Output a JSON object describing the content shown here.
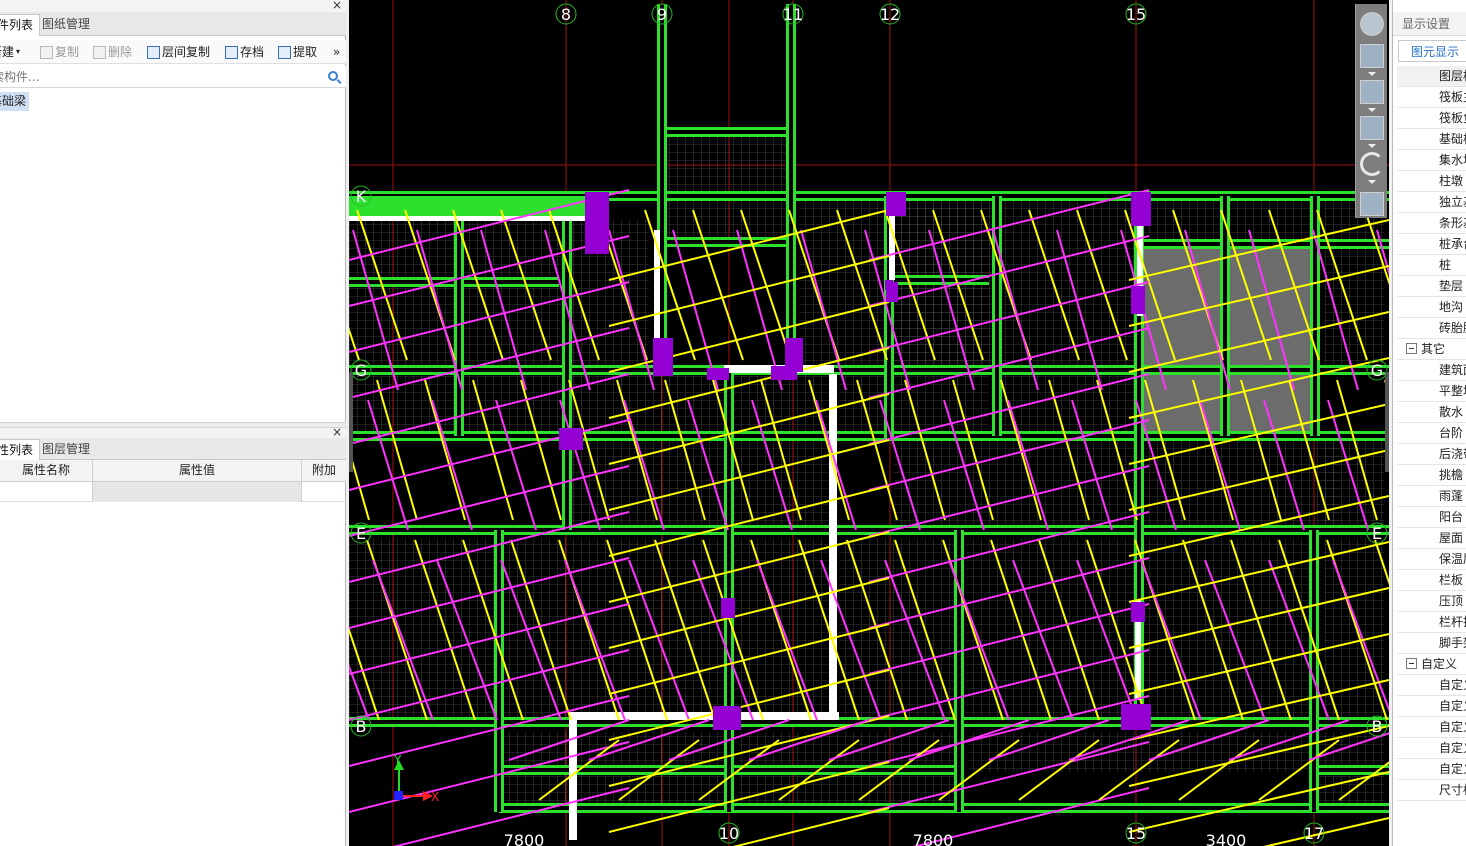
{
  "left_panel": {
    "top_tabs": [
      "构件列表",
      "图纸管理"
    ],
    "toolbar": {
      "new": "新建",
      "copy": "复制",
      "delete": "删除",
      "floor_copy": "层间复制",
      "save": "存档",
      "extract": "提取",
      "more": "»"
    },
    "search_placeholder": "搜索构件...",
    "tree_item": "基础梁",
    "bottom_tabs": [
      "属性列表",
      "图层管理"
    ],
    "prop_columns": [
      "属性名称",
      "属性值",
      "附加"
    ],
    "close_glyph": "×"
  },
  "canvas": {
    "axis_labels_top": [
      "8",
      "9",
      "11",
      "12",
      "15"
    ],
    "axis_labels_left": [
      "K",
      "G",
      "E",
      "B"
    ],
    "axis_labels_right": [
      "G",
      "E",
      "B"
    ],
    "axis_labels_bottom": [
      "10",
      "15",
      "17"
    ],
    "dimensions_bottom": [
      "7800",
      "7800",
      "3400"
    ],
    "ucs": {
      "y": "Y",
      "x": "X"
    },
    "colors": {
      "background": "#000000",
      "grid": "#7a7a7a",
      "beam": "#2ee02e",
      "axis_line": "#a01010",
      "rebar_yellow": "#ffff00",
      "rebar_magenta": "#ff33ff",
      "column": "#9400d3",
      "wall": "#ffffff"
    },
    "nav_tools": [
      "orbit-icon",
      "view-3d-icon",
      "view-top-icon",
      "view-box-icon",
      "rotate-icon",
      "view-grid-icon"
    ]
  },
  "right_panel": {
    "title": "显示设置",
    "tab": "图元显示",
    "header": "图层构件",
    "items": [
      {
        "label": "筏板主筋",
        "type": "item"
      },
      {
        "label": "筏板负筋",
        "type": "item"
      },
      {
        "label": "基础板带",
        "type": "item"
      },
      {
        "label": "集水坑",
        "type": "item"
      },
      {
        "label": "柱墩",
        "type": "item"
      },
      {
        "label": "独立基础",
        "type": "item"
      },
      {
        "label": "条形基础",
        "type": "item"
      },
      {
        "label": "桩承台",
        "type": "item"
      },
      {
        "label": "桩",
        "type": "item"
      },
      {
        "label": "垫层",
        "type": "item"
      },
      {
        "label": "地沟",
        "type": "item"
      },
      {
        "label": "砖胎膜",
        "type": "item"
      },
      {
        "label": "其它",
        "type": "group"
      },
      {
        "label": "建筑面积",
        "type": "item"
      },
      {
        "label": "平整场地",
        "type": "item"
      },
      {
        "label": "散水",
        "type": "item"
      },
      {
        "label": "台阶",
        "type": "item"
      },
      {
        "label": "后浇带",
        "type": "item"
      },
      {
        "label": "挑檐",
        "type": "item"
      },
      {
        "label": "雨蓬",
        "type": "item"
      },
      {
        "label": "阳台",
        "type": "item"
      },
      {
        "label": "屋面",
        "type": "item"
      },
      {
        "label": "保温层",
        "type": "item"
      },
      {
        "label": "栏板",
        "type": "item"
      },
      {
        "label": "压顶",
        "type": "item"
      },
      {
        "label": "栏杆扶手",
        "type": "item"
      },
      {
        "label": "脚手架",
        "type": "item"
      },
      {
        "label": "自定义",
        "type": "group"
      },
      {
        "label": "自定义点",
        "type": "item"
      },
      {
        "label": "自定义线",
        "type": "item"
      },
      {
        "label": "自定义面",
        "type": "item"
      },
      {
        "label": "自定义贴",
        "type": "item"
      },
      {
        "label": "自定义钢",
        "type": "item"
      },
      {
        "label": "尺寸标注",
        "type": "item"
      }
    ]
  }
}
